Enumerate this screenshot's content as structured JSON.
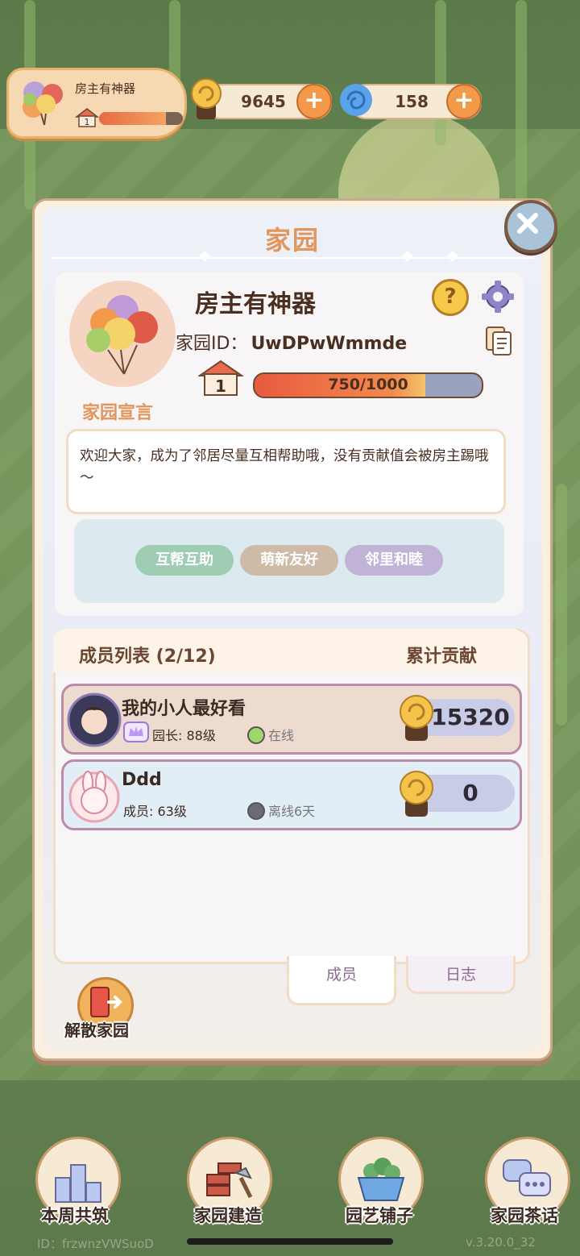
{
  "hud": {
    "home_name": "房主有神器",
    "home_level": "1",
    "home_progress": 0.8,
    "coins": "9645",
    "gems": "158"
  },
  "modal": {
    "title": "家园",
    "owner_name": "房主有神器",
    "home_id_label": "家园ID：",
    "home_id": "UwDPwWmmde",
    "level": "1",
    "exp_text": "750/1000",
    "exp_fraction": 0.75,
    "declaration_label": "家园宣言",
    "declaration": "欢迎大家，成为了邻居尽量互相帮助哦，没有贡献值会被房主踢哦～",
    "tags": [
      {
        "label": "互帮互助",
        "color": "#9fcdb3"
      },
      {
        "label": "萌新友好",
        "color": "#cdbba8"
      },
      {
        "label": "邻里和睦",
        "color": "#c0b3d6"
      }
    ],
    "help_icon": "?",
    "members_title": "成员列表 (2/12)",
    "contribution_title": "累计贡献",
    "members": [
      {
        "name": "我的小人最好看",
        "role": "园长: 88级",
        "status": "在线",
        "status_color": "#9fd86a",
        "score": "15320",
        "row_bg": "#eedbd0"
      },
      {
        "name": "Ddd",
        "role": "成员: 63级",
        "status": "离线6天",
        "status_color": "#6b6b73",
        "score": "0",
        "row_bg": "#e2eef6"
      }
    ],
    "tab_members": "成员",
    "tab_log": "日志",
    "dismiss_label": "解散家园"
  },
  "nav": [
    {
      "label": "本周共筑",
      "icon": "podium-icon"
    },
    {
      "label": "家园建造",
      "icon": "bricks-icon"
    },
    {
      "label": "园艺铺子",
      "icon": "plant-shop-icon"
    },
    {
      "label": "家园茶话",
      "icon": "chat-icon"
    }
  ],
  "footer": {
    "id_text": "ID：frzwnzVWSuoD",
    "version": "v.3.20.0_32"
  },
  "colors": {
    "accent": "#e0965c",
    "plus_button": "#f29a4a",
    "exp_fill": "#e85a40"
  }
}
